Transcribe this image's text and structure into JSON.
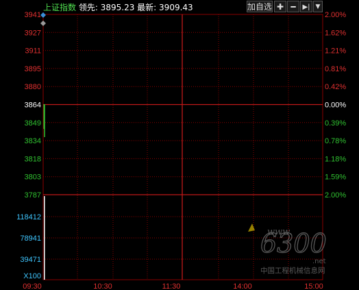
{
  "header": {
    "index_name": "上证指数",
    "lead_label": "领先:",
    "lead_value": "3895.23",
    "latest_label": "最新:",
    "latest_value": "3909.43",
    "add_watchlist_label": "加自选"
  },
  "price_axis": {
    "left_labels": [
      "3941",
      "3927",
      "3911",
      "3895",
      "3880",
      "3864",
      "3849",
      "3834",
      "3818",
      "3803",
      "3787"
    ],
    "right_labels": [
      "2.00%",
      "1.62%",
      "1.21%",
      "0.81%",
      "0.42%",
      "0.00%",
      "0.39%",
      "0.78%",
      "1.18%",
      "1.59%",
      "2.00%"
    ],
    "colors": {
      "up": "#e03030",
      "flat": "#ffffff",
      "down": "#30c030"
    }
  },
  "volume_axis": {
    "labels": [
      "118412",
      "78941",
      "39471",
      "X100"
    ],
    "color": "#3fc6ff"
  },
  "time_axis": {
    "labels": [
      "09:30",
      "10:30",
      "11:30",
      "14:00",
      "15:00"
    ],
    "color": "#e03030"
  },
  "watermark": {
    "text_big": "6300",
    "text_www": "www.",
    "text_net": ".net",
    "text_cn": "中国工程机械信息网"
  },
  "colors": {
    "grid": "#8b0000",
    "grid_strong": "#c01818",
    "line_price": "#30c030",
    "volume_bar": "#ffffff",
    "marker_blue": "#3a8fd8",
    "marker_gray": "#9a9a9a"
  }
}
